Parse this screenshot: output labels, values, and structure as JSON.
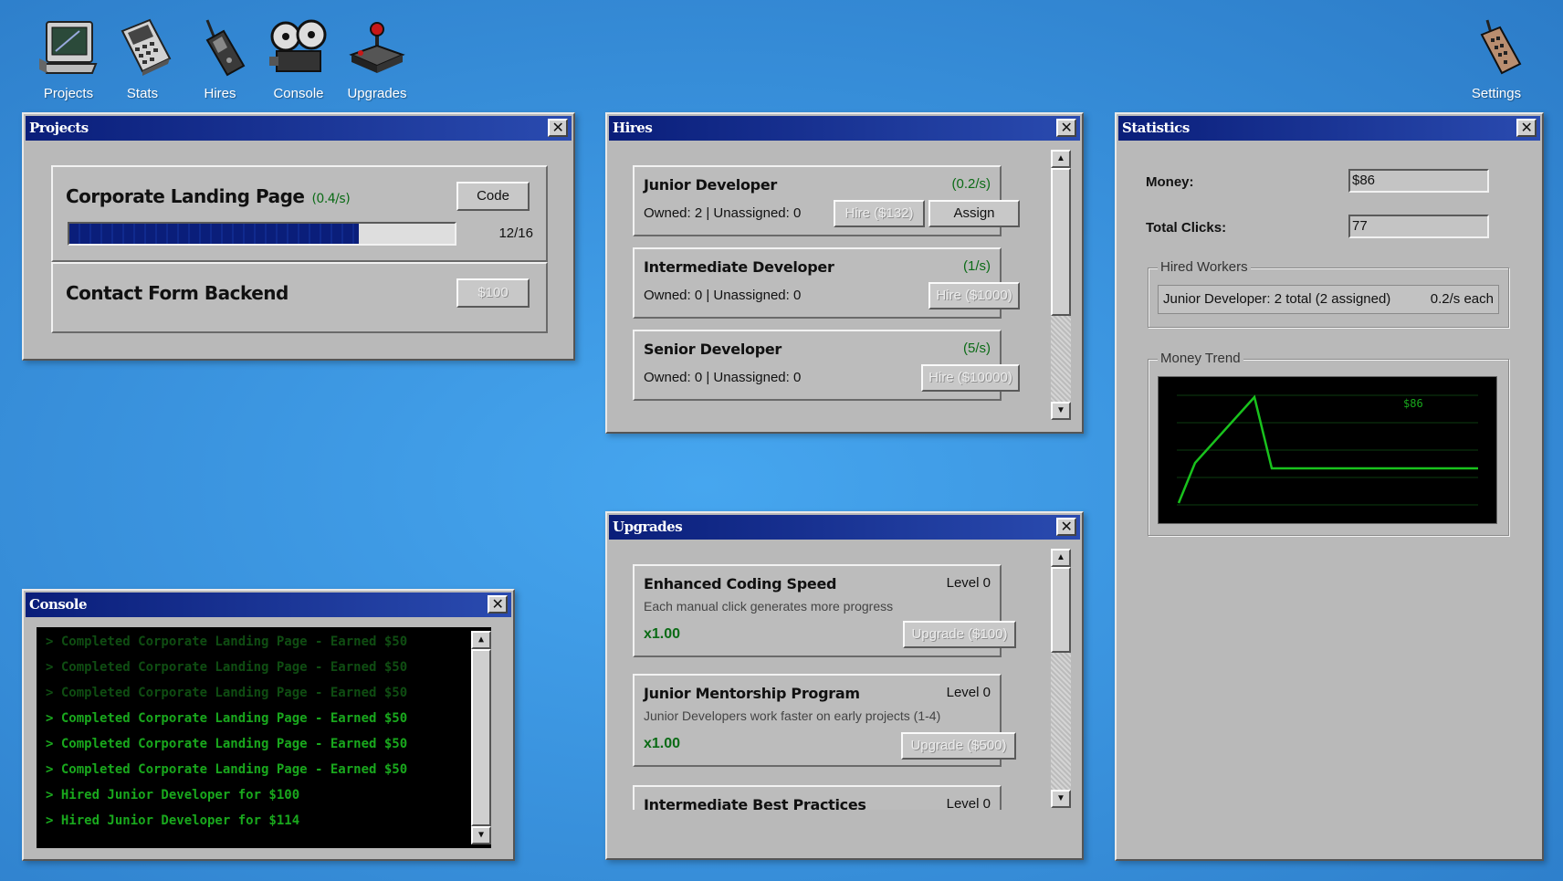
{
  "desktop": {
    "icons": [
      {
        "label": "Projects",
        "icon": "computer-monitor-icon"
      },
      {
        "label": "Stats",
        "icon": "calculator-icon"
      },
      {
        "label": "Hires",
        "icon": "walkie-talkie-icon"
      },
      {
        "label": "Console",
        "icon": "film-projector-icon"
      },
      {
        "label": "Upgrades",
        "icon": "joystick-icon"
      }
    ],
    "settings": {
      "label": "Settings",
      "icon": "remote-control-icon"
    }
  },
  "projects_window": {
    "title": "Projects",
    "close": "✕",
    "items": [
      {
        "name": "Corporate Landing Page",
        "rate": "(0.4/s)",
        "button": "Code",
        "progress_text": "12/16",
        "progress": 0.75
      },
      {
        "name": "Contact Form Backend",
        "button": "$100"
      }
    ]
  },
  "hires_window": {
    "title": "Hires",
    "close": "✕",
    "items": [
      {
        "name": "Junior Developer",
        "rate": "(0.2/s)",
        "owned": "Owned: 2 | Unassigned: 0",
        "hire_button": "Hire ($132)",
        "assign_button": "Assign"
      },
      {
        "name": "Intermediate Developer",
        "rate": "(1/s)",
        "owned": "Owned: 0 | Unassigned: 0",
        "hire_button": "Hire ($1000)"
      },
      {
        "name": "Senior Developer",
        "rate": "(5/s)",
        "owned": "Owned: 0 | Unassigned: 0",
        "hire_button": "Hire ($10000)"
      }
    ]
  },
  "upgrades_window": {
    "title": "Upgrades",
    "close": "✕",
    "items": [
      {
        "name": "Enhanced Coding Speed",
        "level": "Level 0",
        "desc": "Each manual click generates more progress",
        "mult": "x1.00",
        "button": "Upgrade ($100)"
      },
      {
        "name": "Junior Mentorship Program",
        "level": "Level 0",
        "desc": "Junior Developers work faster on early projects (1-4)",
        "mult": "x1.00",
        "button": "Upgrade ($500)"
      },
      {
        "name": "Intermediate Best Practices",
        "level": "Level 0"
      }
    ]
  },
  "statistics_window": {
    "title": "Statistics",
    "close": "✕",
    "money_label": "Money:",
    "money_value": "$86",
    "clicks_label": "Total Clicks:",
    "clicks_value": "77",
    "hired_workers_label": "Hired Workers",
    "hired_worker_row": {
      "text": "Junior Developer: 2 total (2 assigned)",
      "rate": "0.2/s each"
    },
    "money_trend_label": "Money Trend",
    "trend_value_label": "$86",
    "line_color": "#19c21d"
  },
  "console_window": {
    "title": "Console",
    "close": "✕",
    "lines": [
      {
        "text": "> Completed Corporate Landing Page - Earned $50",
        "dim": true
      },
      {
        "text": "> Completed Corporate Landing Page - Earned $50",
        "dim": true
      },
      {
        "text": "> Completed Corporate Landing Page - Earned $50",
        "dim": true
      },
      {
        "text": "> Completed Corporate Landing Page - Earned $50",
        "dim": false
      },
      {
        "text": "> Completed Corporate Landing Page - Earned $50",
        "dim": false
      },
      {
        "text": "> Completed Corporate Landing Page - Earned $50",
        "dim": false
      },
      {
        "text": "> Hired Junior Developer for $100",
        "dim": false
      },
      {
        "text": "> Hired Junior Developer for $114",
        "dim": false
      }
    ]
  },
  "colors": {
    "desktop": "#3a93de",
    "titlebar_start": "#0a1e7a",
    "titlebar_end": "#2a4bb0",
    "progress_fill": "#0a1e7a",
    "accent_green": "#0b6b16"
  }
}
